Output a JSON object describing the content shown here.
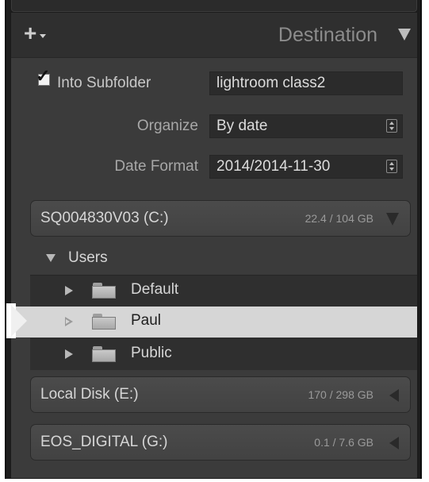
{
  "header": {
    "add_icon": "plus-icon",
    "title": "Destination",
    "collapse_icon": "triangle-down-icon"
  },
  "subfolder": {
    "checked": true,
    "label": "Into Subfolder",
    "value": "lightroom class2"
  },
  "organize": {
    "label": "Organize",
    "selected": "By date"
  },
  "date_format": {
    "label": "Date Format",
    "selected": "2014/2014-11-30"
  },
  "volumes": [
    {
      "name": "SQ004830V03 (C:)",
      "usage": "22.4 / 104 GB",
      "expanded": true,
      "tree": {
        "root": "Users",
        "folders": [
          {
            "label": "Default",
            "selected": false
          },
          {
            "label": "Paul",
            "selected": true
          },
          {
            "label": "Public",
            "selected": false
          }
        ]
      }
    },
    {
      "name": "Local Disk (E:)",
      "usage": "170 / 298 GB",
      "expanded": false
    },
    {
      "name": "EOS_DIGITAL (G:)",
      "usage": "0.1 / 7.6 GB",
      "expanded": false
    }
  ],
  "colors": {
    "panel": "#3b3b3b",
    "selected_row": "#d6d6d6",
    "text": "#d6d6d6"
  }
}
